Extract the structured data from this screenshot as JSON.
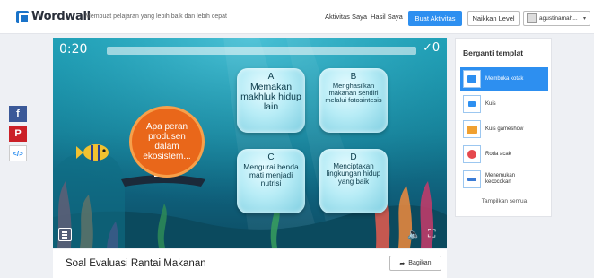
{
  "header": {
    "logo": "Wordwall",
    "tagline": "Membuat pelajaran yang lebih baik dan lebih cepat",
    "nav": [
      "Aktivitas Saya",
      "Hasil Saya"
    ],
    "create_label": "Buat Aktivitas",
    "upgrade_label": "Naikkan Level",
    "username": "agustinamah..."
  },
  "share_sidebar": [
    "f",
    "P",
    "</>"
  ],
  "game": {
    "timer": "0:20",
    "score": "✓0",
    "question": "Apa peran produsen dalam ekosistem...",
    "answers": [
      {
        "letter": "A",
        "text": "Memakan makhluk hidup lain"
      },
      {
        "letter": "B",
        "text": "Menghasilkan makanan sendiri melalui fotosintesis"
      },
      {
        "letter": "C",
        "text": "Mengurai benda mati menjadi nutrisi"
      },
      {
        "letter": "D",
        "text": "Menciptakan lingkungan hidup yang baik"
      }
    ]
  },
  "template_panel": {
    "title": "Berganti templat",
    "items": [
      {
        "label": "Membuka kotak",
        "icon": "open-box-icon",
        "active": true
      },
      {
        "label": "Kuis",
        "icon": "quiz-icon",
        "active": false
      },
      {
        "label": "Kuis gameshow",
        "icon": "gameshow-icon",
        "active": false
      },
      {
        "label": "Roda acak",
        "icon": "wheel-icon",
        "active": false
      },
      {
        "label": "Menemukan kecocokan",
        "icon": "match-icon",
        "active": false
      }
    ],
    "show_all": "Tampilkan semua"
  },
  "activity": {
    "title": "Soal Evaluasi Rantai Makanan",
    "share_label": "Bagikan"
  },
  "colors": {
    "accent": "#2d8ff0",
    "water": "#157e96",
    "bubble": "#e9671a"
  }
}
